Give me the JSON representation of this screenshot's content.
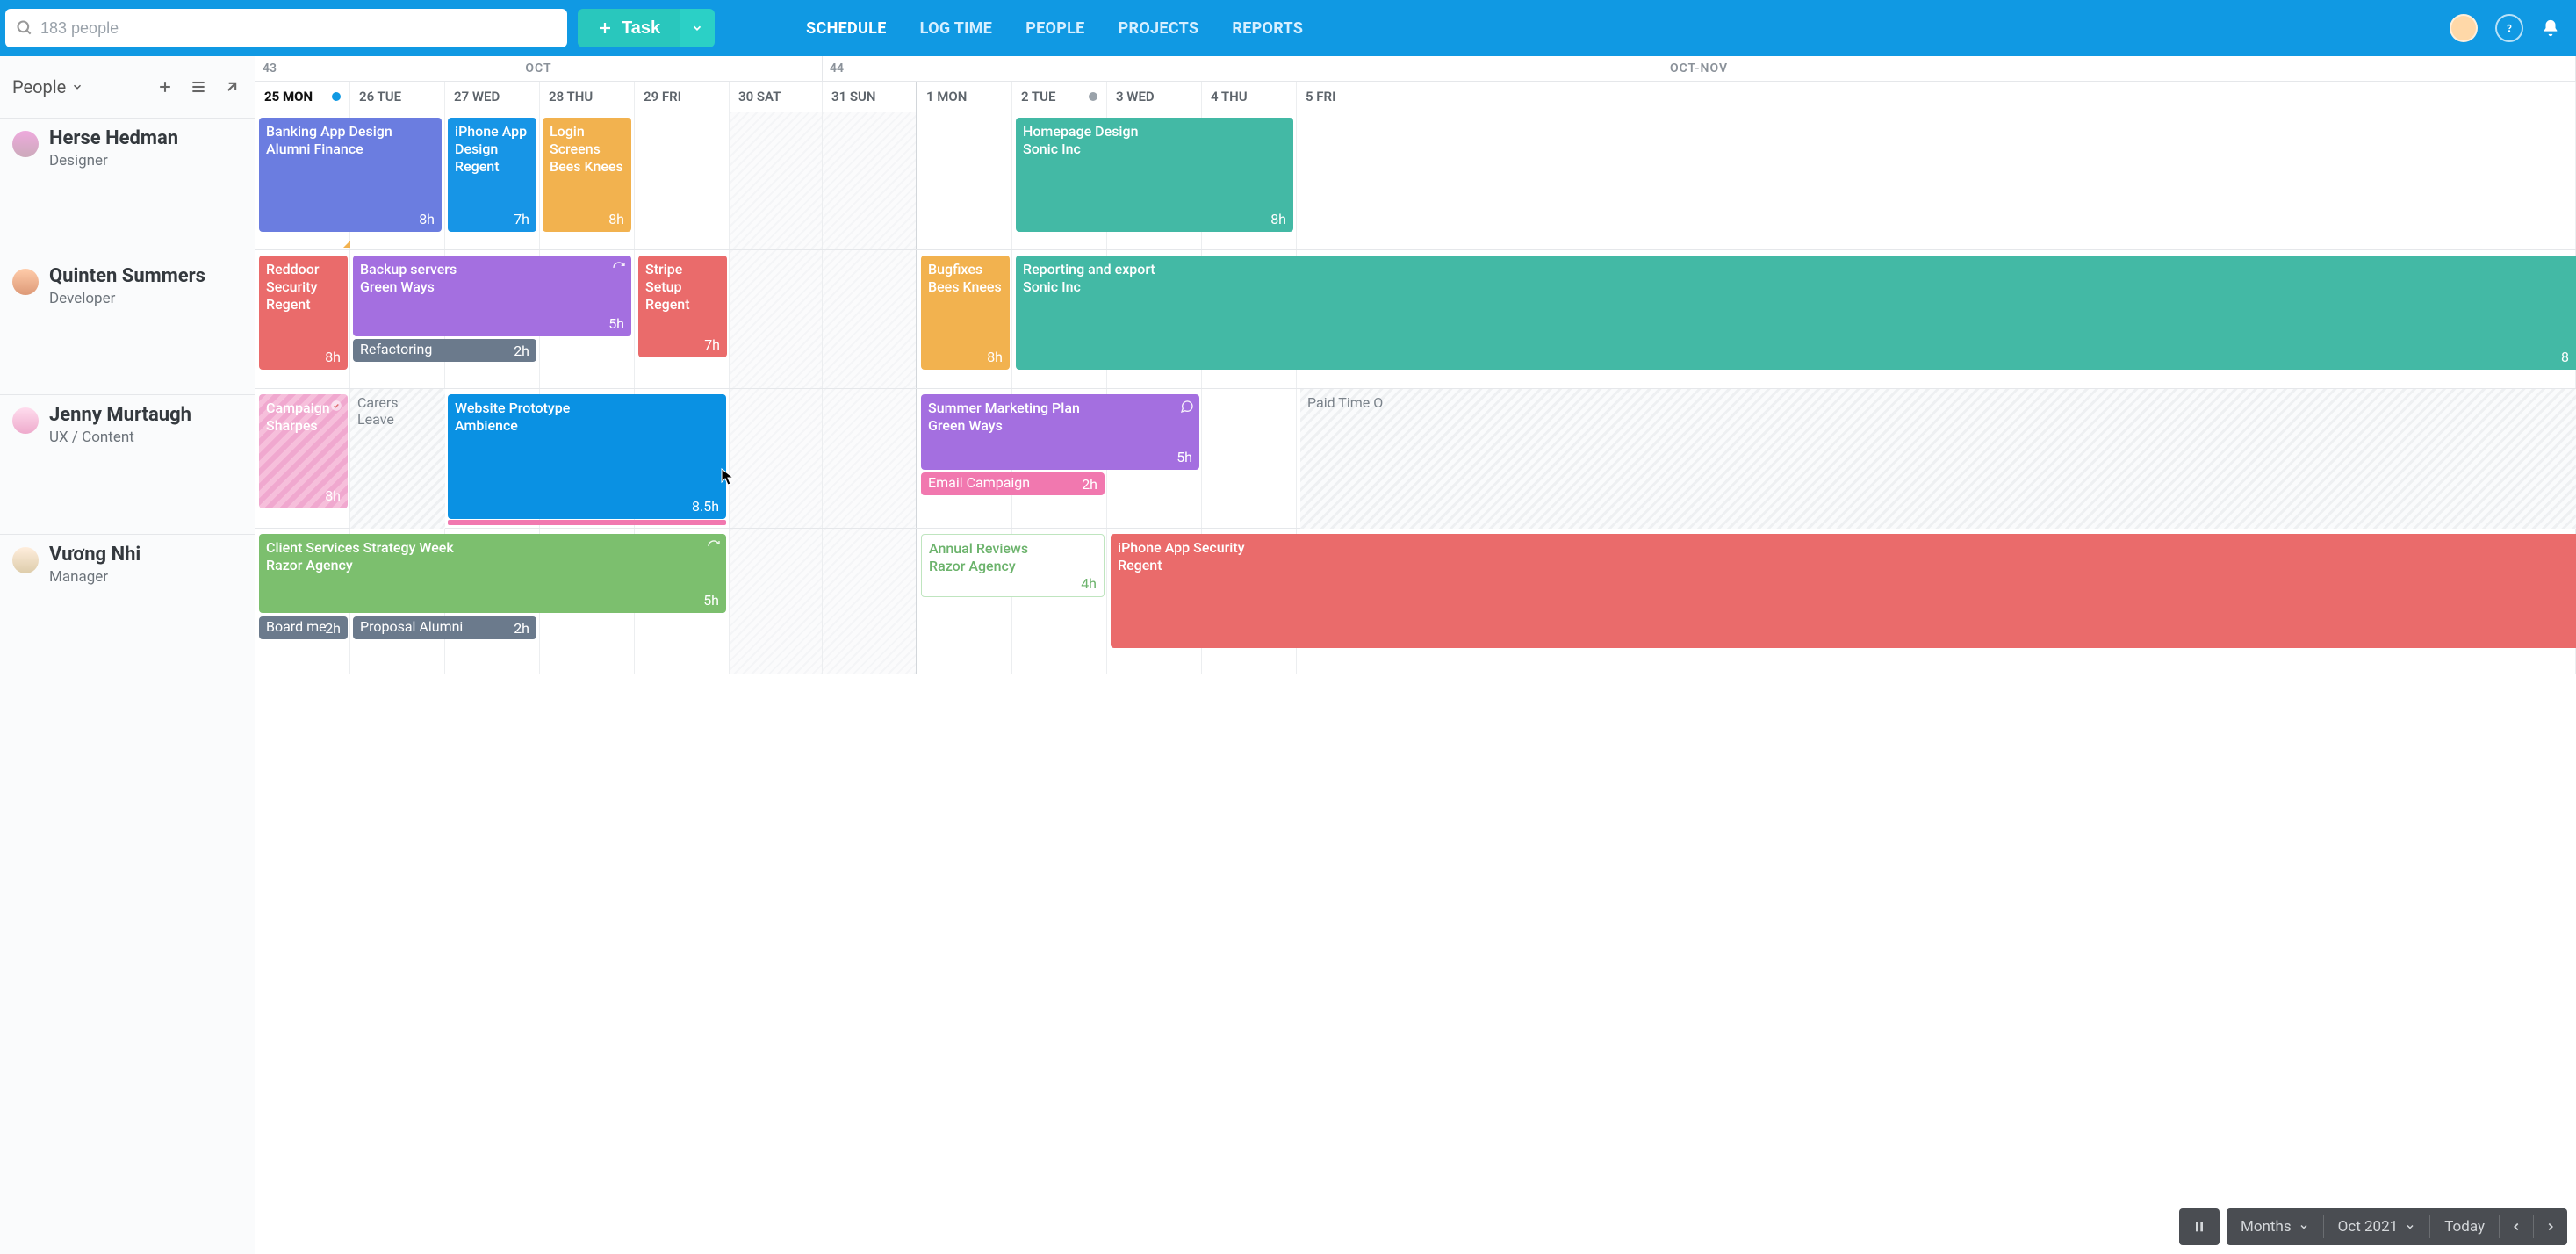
{
  "topbar": {
    "search_placeholder": "183 people",
    "task_button": "Task",
    "nav": {
      "schedule": "SCHEDULE",
      "log_time": "LOG TIME",
      "people": "PEOPLE",
      "projects": "PROJECTS",
      "reports": "REPORTS"
    }
  },
  "sidebar": {
    "title": "People"
  },
  "people": [
    {
      "name": "Herse Hedman",
      "role": "Designer"
    },
    {
      "name": "Quinten Summers",
      "role": "Developer"
    },
    {
      "name": "Jenny Murtaugh",
      "role": "UX / Content"
    },
    {
      "name": "Vương Nhi",
      "role": "Manager"
    }
  ],
  "calendar": {
    "weeks": [
      {
        "number": "43",
        "month_label": "OCT"
      },
      {
        "number": "44",
        "month_label": "OCT-NOV"
      }
    ],
    "days": [
      {
        "label": "25 MON",
        "today": true,
        "dot": "blue"
      },
      {
        "label": "26 TUE"
      },
      {
        "label": "27 WED"
      },
      {
        "label": "28 THU"
      },
      {
        "label": "29 FRI"
      },
      {
        "label": "30 SAT",
        "weekend": true
      },
      {
        "label": "31 SUN",
        "weekend": true
      },
      {
        "label": "1 MON"
      },
      {
        "label": "2 TUE",
        "dot": "grey"
      },
      {
        "label": "3 WED"
      },
      {
        "label": "4 THU"
      },
      {
        "label": "5 FRI"
      }
    ]
  },
  "tasks": {
    "hedman": {
      "banking": {
        "title": "Banking App Design",
        "client": "Alumni Finance",
        "hours": "8h",
        "color": "#6b7de0"
      },
      "iphone": {
        "title": "iPhone App Design",
        "client": "Regent",
        "hours": "7h",
        "color": "#1795e6"
      },
      "login": {
        "title": "Login Screens",
        "client": "Bees Knees",
        "hours": "8h",
        "color": "#f2b24f"
      },
      "homepage": {
        "title": "Homepage Design",
        "client": "Sonic Inc",
        "hours": "8h",
        "color": "#43b9a5"
      }
    },
    "summers": {
      "reddoor": {
        "title": "Reddoor Security",
        "client": "Regent",
        "hours": "8h",
        "color": "#ea6b6b"
      },
      "backup": {
        "title": "Backup servers",
        "client": "Green Ways",
        "hours": "5h",
        "color": "#a46fe0"
      },
      "refactor": {
        "title": "Refactoring",
        "hours": "2h",
        "color": "#6b7a8c"
      },
      "stripe": {
        "title": "Stripe Setup",
        "client": "Regent",
        "hours": "7h",
        "color": "#ea6b6b"
      },
      "bugfix": {
        "title": "Bugfixes",
        "client": "Bees Knees",
        "hours": "8h",
        "color": "#f2b24f"
      },
      "reporting": {
        "title": "Reporting and export",
        "client": "Sonic Inc",
        "hours": "8",
        "color": "#43b9a5"
      }
    },
    "murtaugh": {
      "campaign": {
        "title": "Campaign",
        "client": "Sharpes",
        "hours": "8h"
      },
      "carers": {
        "title": "Carers Leave"
      },
      "website": {
        "title": "Website Prototype",
        "client": "Ambience",
        "hours": "8.5h",
        "color": "#0a91e3"
      },
      "summer": {
        "title": "Summer Marketing Plan",
        "client": "Green Ways",
        "hours": "5h",
        "color": "#a46fe0"
      },
      "email": {
        "title": "Email Campaign",
        "hours": "2h",
        "color": "#f178af"
      },
      "pto": {
        "title": "Paid Time O"
      }
    },
    "nhi": {
      "client": {
        "title": "Client Services Strategy Week",
        "client": "Razor Agency",
        "hours": "5h",
        "color": "#7cbf6e"
      },
      "board": {
        "title": "Board me",
        "hours": "2h",
        "color": "#6b7a8c"
      },
      "proposal": {
        "title": "Proposal Alumni",
        "hours": "2h",
        "color": "#6b7a8c"
      },
      "annual": {
        "title": "Annual Reviews",
        "client": "Razor Agency",
        "hours": "4h"
      },
      "security": {
        "title": "iPhone App Security",
        "client": "Regent",
        "color": "#ea6b6b"
      }
    }
  },
  "bottom": {
    "view": "Months",
    "range": "Oct 2021",
    "today": "Today"
  },
  "colors": {
    "brand": "#1099e3",
    "task_btn": "#29c7bd"
  }
}
